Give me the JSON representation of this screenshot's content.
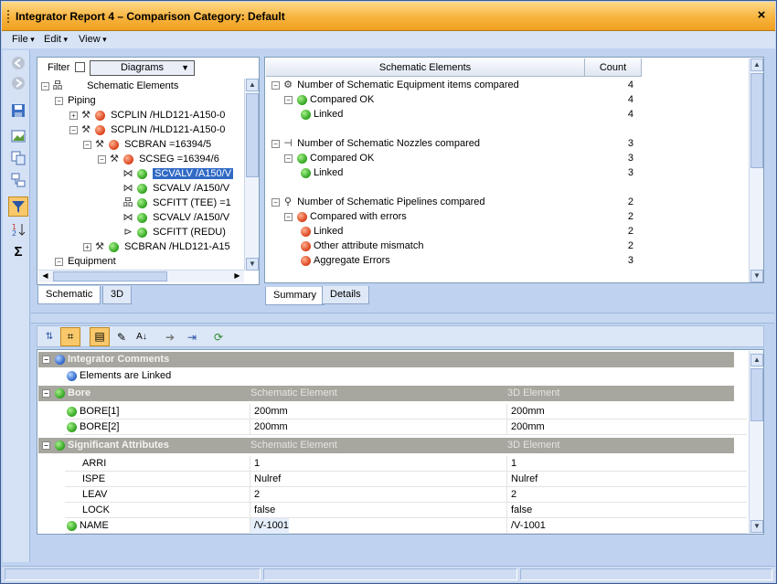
{
  "window": {
    "title": "Integrator Report 4 – Comparison Category: Default",
    "close_label": "×"
  },
  "menu": [
    "File",
    "Edit",
    "View"
  ],
  "left_tree": {
    "filter_label": "Filter",
    "filter_value": "Diagrams",
    "rows": [
      {
        "text": "Schematic Elements"
      },
      {
        "text": "Piping"
      },
      {
        "text": "SCPLIN /HLD121-A150-0"
      },
      {
        "text": "SCPLIN /HLD121-A150-0"
      },
      {
        "text": "SCBRAN =16394/5"
      },
      {
        "text": "SCSEG =16394/6"
      },
      {
        "text": "SCVALV /A150/V"
      },
      {
        "text": "SCVALV /A150/V"
      },
      {
        "text": "SCFITT (TEE) =1"
      },
      {
        "text": "SCVALV /A150/V"
      },
      {
        "text": "SCFITT (REDU)"
      },
      {
        "text": "SCBRAN /HLD121-A15"
      },
      {
        "text": "Equipment"
      }
    ],
    "tabs": [
      "Schematic",
      "3D"
    ]
  },
  "summary": {
    "columns": [
      "Schematic Elements",
      "Count"
    ],
    "rows": [
      {
        "text": "Number of Schematic Equipment items compared",
        "count": "4"
      },
      {
        "text": "Compared OK",
        "count": "4"
      },
      {
        "text": "Linked",
        "count": "4"
      },
      {
        "text": "Number of Schematic Nozzles compared",
        "count": "3"
      },
      {
        "text": "Compared OK",
        "count": "3"
      },
      {
        "text": "Linked",
        "count": "3"
      },
      {
        "text": "Number of Schematic Pipelines compared",
        "count": "2"
      },
      {
        "text": "Compared with errors",
        "count": "2"
      },
      {
        "text": "Linked",
        "count": "2"
      },
      {
        "text": "Other attribute mismatch",
        "count": "2"
      },
      {
        "text": "Aggregate Errors",
        "count": "3"
      }
    ],
    "tabs": [
      "Summary",
      "Details"
    ]
  },
  "details": {
    "comments_header": "Integrator Comments",
    "comment": "Elements are Linked",
    "bore_header": "Bore",
    "col_schematic": "Schematic Element",
    "col_3d": "3D Element",
    "bore_rows": [
      {
        "name": "BORE[1]",
        "schematic": "200mm",
        "d3": "200mm"
      },
      {
        "name": "BORE[2]",
        "schematic": "200mm",
        "d3": "200mm"
      }
    ],
    "sig_header": "Significant Attributes",
    "sig_rows": [
      {
        "name": "ARRI",
        "schematic": "1",
        "d3": "1"
      },
      {
        "name": "ISPE",
        "schematic": "Nulref",
        "d3": "Nulref"
      },
      {
        "name": "LEAV",
        "schematic": "2",
        "d3": "2"
      },
      {
        "name": "LOCK",
        "schematic": "false",
        "d3": "false"
      },
      {
        "name": "NAME",
        "schematic": "/V-1001",
        "d3": "/V-1001"
      }
    ]
  },
  "colors": {
    "title_orange": "#f7b33d",
    "selection": "#316ac5",
    "group_header": "#a7a69f"
  }
}
